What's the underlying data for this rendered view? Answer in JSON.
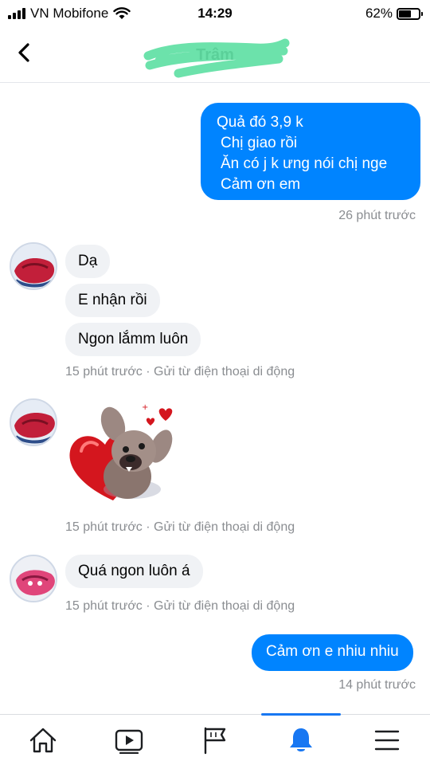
{
  "status_bar": {
    "carrier": "VN Mobifone",
    "time": "14:29",
    "battery_percent_text": "62%",
    "battery_level": 0.62
  },
  "header": {
    "contact_name": "Trâm"
  },
  "messages": {
    "sent1": {
      "lines": [
        "Quả đó 3,9 k",
        "Chị giao rồi",
        "Ăn có j k ưng nói chị nge",
        "Cảm ơn em"
      ],
      "time": "26 phút trước"
    },
    "recv1": {
      "bubbles": [
        "Dạ",
        "E nhận rồi",
        "Ngon lắmm luôn"
      ],
      "meta": "15 phút trước · Gửi từ điện thoại di động"
    },
    "recv2": {
      "sticker": "mouse-heart-sticker",
      "meta": "15 phút trước · Gửi từ điện thoại di động"
    },
    "recv3": {
      "bubbles": [
        "Quá ngon luôn á"
      ],
      "meta": "15 phút trước · Gửi từ điện thoại di động"
    },
    "sent2": {
      "text": "Cảm ơn e nhiu nhiu",
      "time": "14 phút trước"
    }
  },
  "nav": {
    "items": [
      "home-icon",
      "video-icon",
      "flag-icon",
      "bell-icon",
      "menu-icon"
    ],
    "active": "bell-icon"
  },
  "colors": {
    "accent": "#0084ff",
    "nav_active": "#1877f2",
    "incoming_bubble": "#f0f2f5",
    "meta_text": "#8a8d91"
  }
}
